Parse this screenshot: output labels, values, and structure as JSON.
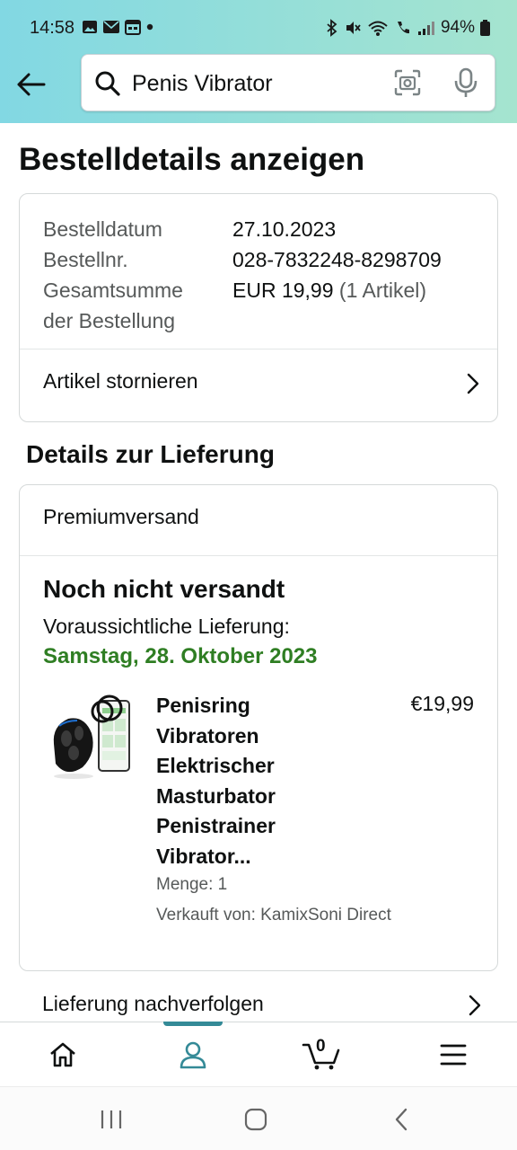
{
  "status_bar": {
    "time": "14:58",
    "battery": "94%"
  },
  "search": {
    "query": "Penis Vibrator"
  },
  "page": {
    "title": "Bestelldetails anzeigen"
  },
  "order_summary": {
    "rows": [
      {
        "label": "Bestelldatum",
        "value": "27.10.2023"
      },
      {
        "label": "Bestellnr.",
        "value": "028-7832248-8298709"
      },
      {
        "label": "Gesamtsumme",
        "label2": "der Bestellung",
        "value": "EUR 19,99",
        "value_suffix": "(1 Artikel)"
      }
    ],
    "cancel_label": "Artikel stornieren"
  },
  "delivery": {
    "section_title": "Details zur Lieferung",
    "shipping_method": "Premiumversand",
    "status": "Noch nicht versandt",
    "expected_label": "Voraussichtliche Lieferung:",
    "expected_date": "Samstag, 28. Oktober 2023",
    "product": {
      "title_lines": [
        "Penisring",
        "Vibratoren",
        "Elektrischer",
        "Masturbator",
        "Penistrainer",
        "Vibrator..."
      ],
      "price": "€19,99",
      "quantity": "Menge: 1",
      "seller": "Verkauft von: KamixSoni Direct"
    },
    "track_label": "Lieferung nachverfolgen"
  },
  "bottom_nav": {
    "cart_count": "0",
    "active": "account"
  },
  "colors": {
    "header_gradient_start": "#82d8e3",
    "header_gradient_end": "#a5e4cf",
    "delivery_green": "#2f7e23",
    "nav_accent": "#348a97"
  }
}
